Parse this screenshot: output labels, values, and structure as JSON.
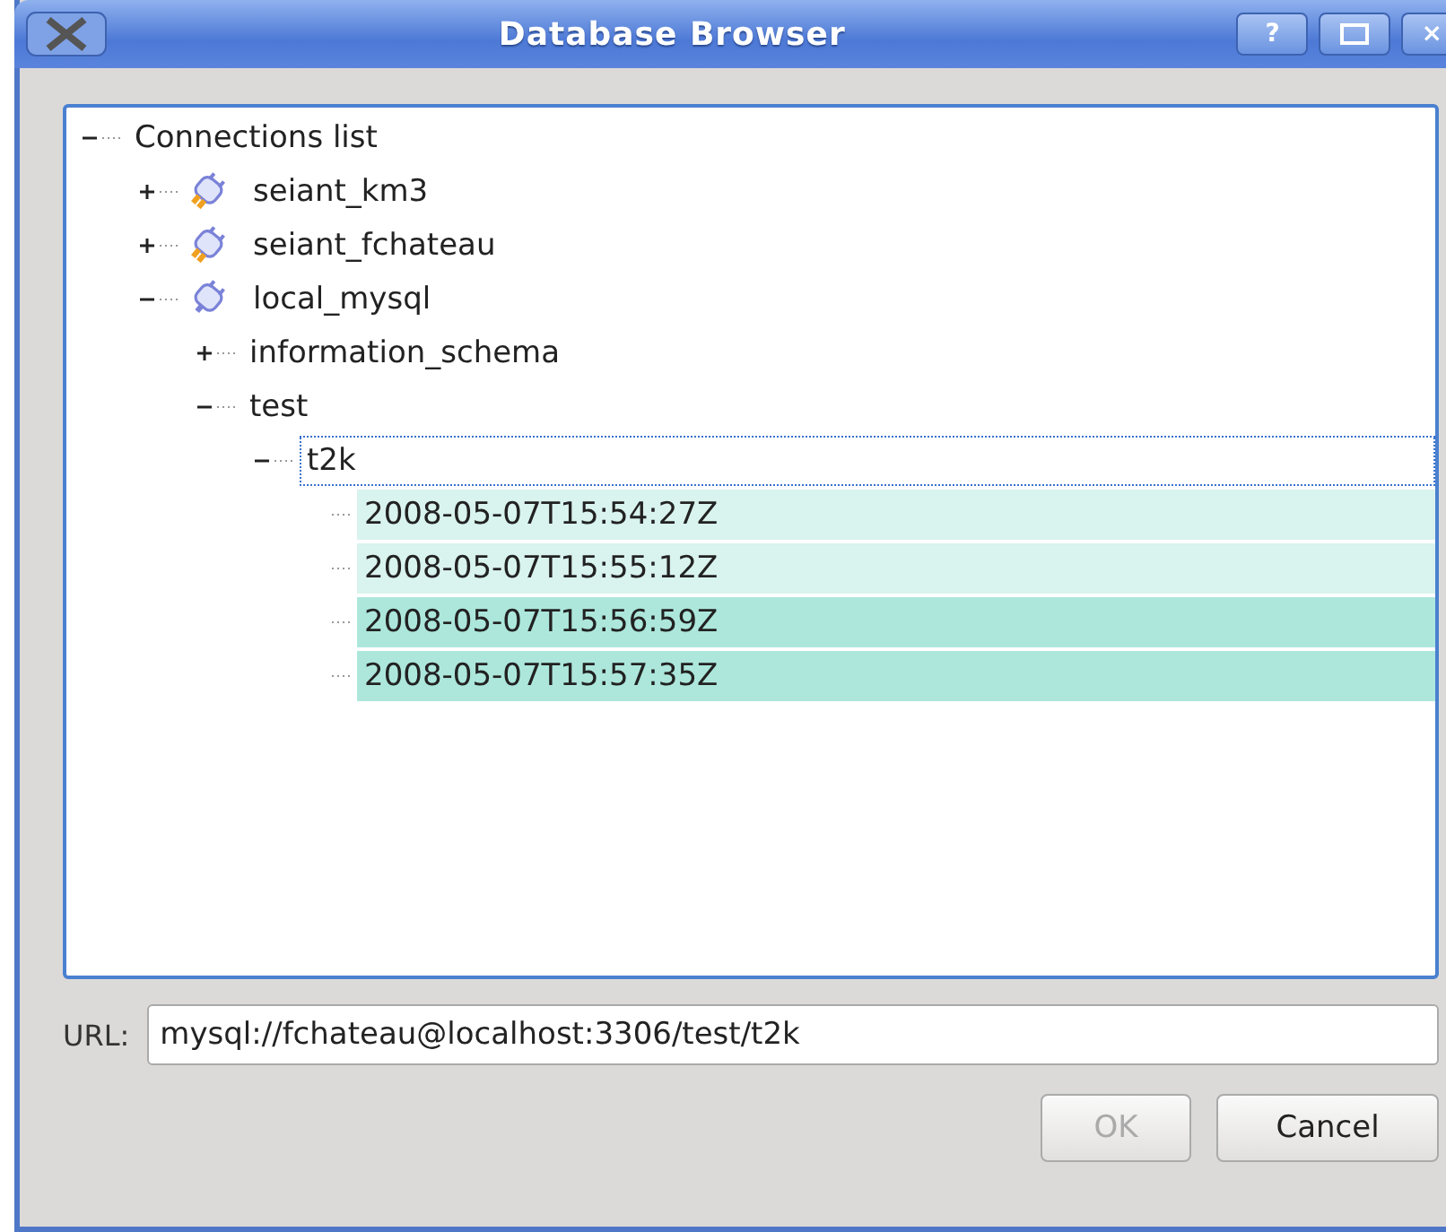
{
  "window": {
    "title": "Database Browser",
    "buttons": [
      "?",
      "×"
    ]
  },
  "tree": [
    {
      "label": "Connections list",
      "expanded": true,
      "children": [
        {
          "label": "seiant_km3",
          "kind": "connection",
          "expanded": false,
          "active": false
        },
        {
          "label": "seiant_fchateau",
          "kind": "connection",
          "expanded": false,
          "active": false
        },
        {
          "label": "local_mysql",
          "kind": "connection",
          "expanded": true,
          "active": true,
          "children": [
            {
              "label": "information_schema",
              "expanded": false
            },
            {
              "label": "test",
              "expanded": true,
              "children": [
                {
                  "label": "t2k",
                  "expanded": true,
                  "focused": true,
                  "children": [
                    {
                      "label": "2008-05-07T15:54:27Z",
                      "color": "#d9f3ee"
                    },
                    {
                      "label": "2008-05-07T15:55:12Z",
                      "color": "#d9f3ee"
                    },
                    {
                      "label": "2008-05-07T15:56:59Z",
                      "color": "#ade7dc"
                    },
                    {
                      "label": "2008-05-07T15:57:35Z",
                      "color": "#ade7dc"
                    }
                  ]
                }
              ]
            }
          ]
        }
      ]
    }
  ],
  "url": {
    "label": "URL:",
    "value": "mysql://fchateau@localhost:3306/test/t2k"
  },
  "buttons": [
    {
      "label": "OK",
      "disabled": true
    },
    {
      "label": "Cancel",
      "disabled": false
    }
  ]
}
